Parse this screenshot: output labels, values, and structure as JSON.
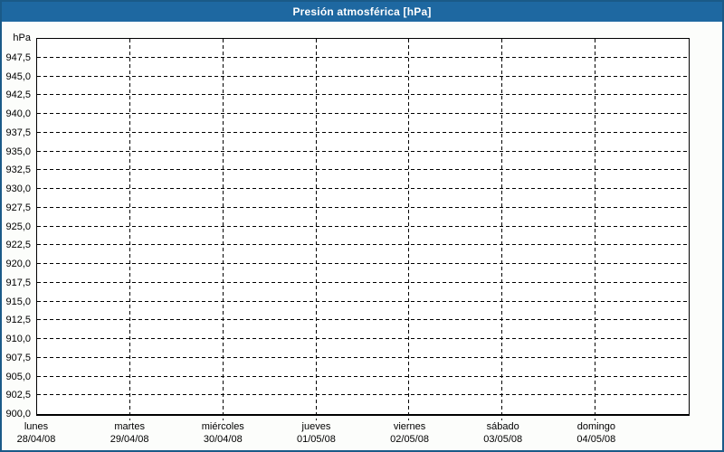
{
  "window": {
    "title": "Presión atmosférica [hPa]"
  },
  "colors": {
    "frame_border": "#1A5A88",
    "titlebar_bg": "#1E68A1",
    "titlebar_text": "#FFFFFF",
    "body_bg": "#FCFDFB",
    "plot_bg": "#FFFFFF",
    "grid": "#000000",
    "label_text": "#000000"
  },
  "chart_data": {
    "type": "line",
    "title": "Presión atmosférica [hPa]",
    "y_axis": {
      "unit": "hPa",
      "min": 900.0,
      "max": 950.0,
      "tick_step": 2.5,
      "tick_labels": [
        "947,5",
        "945,0",
        "942,5",
        "940,0",
        "937,5",
        "935,0",
        "932,5",
        "930,0",
        "927,5",
        "925,0",
        "922,5",
        "920,0",
        "917,5",
        "915,0",
        "912,5",
        "910,0",
        "907,5",
        "905,0",
        "902,5",
        "900,0"
      ]
    },
    "x_axis": {
      "days": [
        {
          "name": "lunes",
          "date": "28/04/08"
        },
        {
          "name": "martes",
          "date": "29/04/08"
        },
        {
          "name": "miércoles",
          "date": "30/04/08"
        },
        {
          "name": "jueves",
          "date": "01/05/08"
        },
        {
          "name": "viernes",
          "date": "02/05/08"
        },
        {
          "name": "sábado",
          "date": "03/05/08"
        },
        {
          "name": "domingo",
          "date": "04/05/08"
        }
      ]
    },
    "series": [],
    "layout": {
      "grid_horizontal": "dashed",
      "grid_vertical": "dashed",
      "legend": "none"
    }
  }
}
